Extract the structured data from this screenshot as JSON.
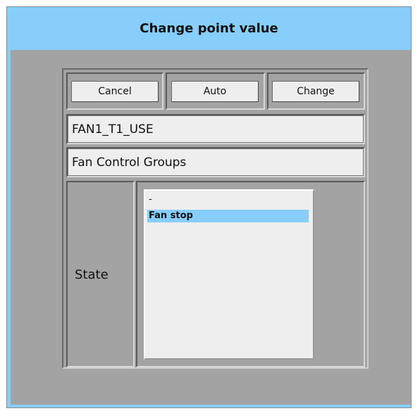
{
  "dialog": {
    "title": "Change point value"
  },
  "buttons": {
    "cancel": "Cancel",
    "auto": "Auto",
    "change": "Change"
  },
  "point": {
    "name": "FAN1_T1_USE",
    "group": "Fan Control Groups"
  },
  "state": {
    "label": "State",
    "options": [
      "-",
      "Fan stop"
    ],
    "selected": "Fan stop"
  },
  "colors": {
    "title_bar": "#87cefa",
    "dialog_bg": "#a3a3a3",
    "selection": "#87cefa"
  }
}
